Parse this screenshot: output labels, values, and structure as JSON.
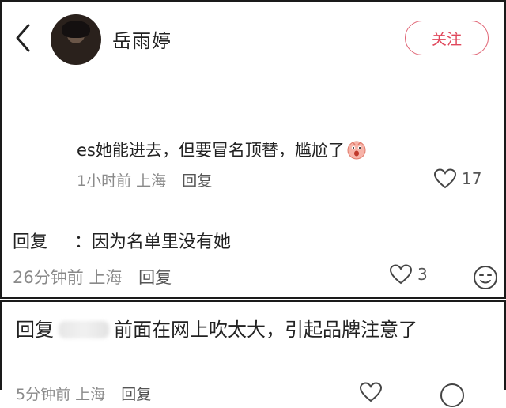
{
  "header": {
    "username": "岳雨婷",
    "follow_label": "关注"
  },
  "comments": [
    {
      "text": "es她能进去，但要冒名顶替，尴尬了",
      "time": "1小时前",
      "location": "上海",
      "reply_label": "回复",
      "likes": "17",
      "emoji": "shocked-face-emoji"
    },
    {
      "prefix": "回复",
      "text": "：因为名单里没有她",
      "time": "26分钟前",
      "location": "上海",
      "reply_label": "回复",
      "likes": "3"
    },
    {
      "prefix": "回复",
      "text": "前面在网上吹太大，引起品牌注意了",
      "time": "5分钟前",
      "location": "上海",
      "reply_label": "回复"
    }
  ],
  "icons": {
    "back": "chevron-left-icon",
    "like": "heart-outline-icon",
    "react": "smiley-face-icon"
  },
  "colors": {
    "accent": "#e0485c",
    "meta": "#8a8a8a"
  }
}
